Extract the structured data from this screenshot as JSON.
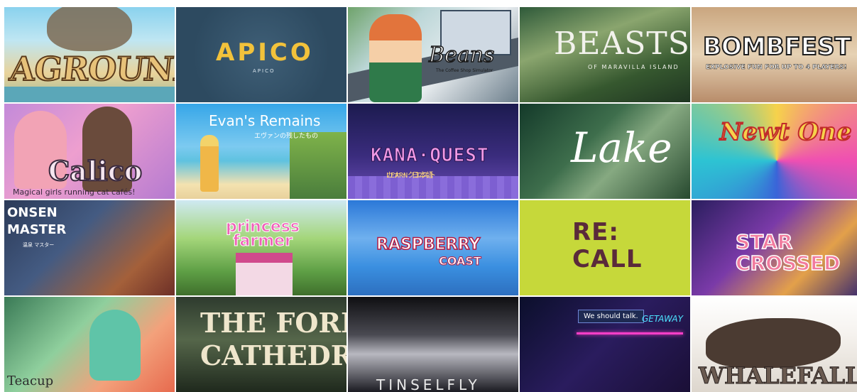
{
  "tiles": {
    "aground": {
      "title": "AGROUND"
    },
    "apico": {
      "title": "APICO",
      "sub": "APICO"
    },
    "beans": {
      "title": "Beans",
      "sub": "The Coffee Shop Simulator"
    },
    "beasts": {
      "title": "BEASTS",
      "sub": "OF MARAVILLA ISLAND"
    },
    "bombfest": {
      "title": "BOMBFEST",
      "sub": "EXPLOSIVE FUN FOR UP TO 4 PLAYERS!"
    },
    "calico": {
      "title": "Calico",
      "sub": "Magical girls running cat cafés!"
    },
    "evans": {
      "title": "Evan's Remains",
      "sub": "エヴァンの残したもの"
    },
    "kana": {
      "top": "LEARN 日本語",
      "title": "KANA·QUEST",
      "sub": "カナ・クエスト"
    },
    "lake": {
      "title": "Lake"
    },
    "newtone": {
      "title": "Newt One"
    },
    "onsen": {
      "title_line1": "ONSEN",
      "title_line2": "MASTER",
      "sub": "温泉 マスター"
    },
    "princess": {
      "title_line1": "princess",
      "title_line2": "farmer"
    },
    "raspberry": {
      "title": "RASPBERRY",
      "sub": "COAST"
    },
    "recall": {
      "title_line1": "RE:",
      "title_line2": "CALL"
    },
    "starcrossed": {
      "title_line1": "STAR",
      "title_line2": "CROSSED"
    },
    "teacup": {
      "title": "Teacup"
    },
    "forest": {
      "title_line1": "THE FOREST",
      "title_line2": "CATHEDRAL"
    },
    "tinsel": {
      "title": "TINSELFLY"
    },
    "getaway": {
      "bubble": "We should talk.",
      "sign": "GETAWAY"
    },
    "whalefall": {
      "title": "WHALEFALL"
    }
  }
}
